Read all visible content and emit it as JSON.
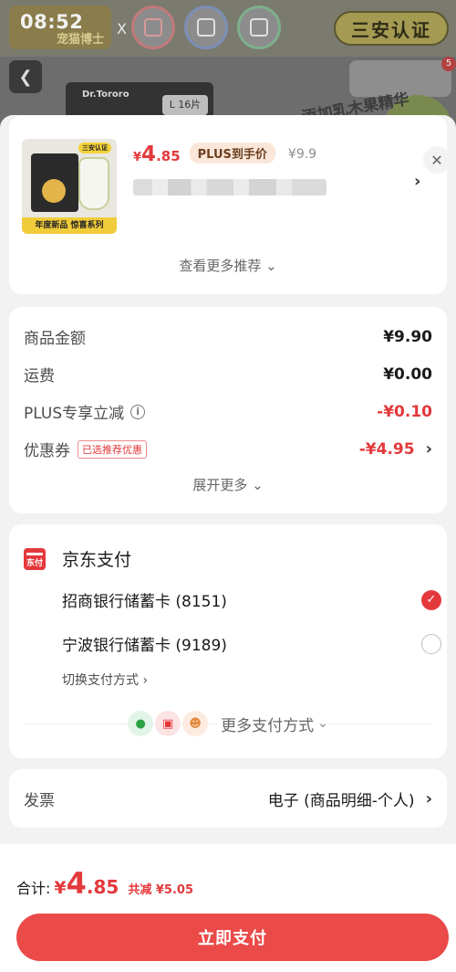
{
  "background": {
    "status_time": "08:52",
    "brand_text": "宠猫博士",
    "brand_multiplier": "X",
    "certification": "三安认证",
    "product_brand": "Dr.Tororo",
    "size_label": "L 16片",
    "slogan": "添加乳木果精华",
    "cart_badge": "5"
  },
  "product": {
    "thumb_cert": "三安认证",
    "thumb_banner": "年度新品 惊喜系列",
    "price_symbol": "¥",
    "price_int": "4",
    "price_dec": ".85",
    "plus_badge": "PLUS到手价",
    "original_price": "¥9.9",
    "more_recommend": "查看更多推荐"
  },
  "summary": {
    "rows": [
      {
        "label": "商品金额",
        "value": "¥9.90"
      },
      {
        "label": "运费",
        "value": "¥0.00"
      },
      {
        "label": "PLUS专享立减",
        "value": "-¥0.10"
      },
      {
        "label": "优惠券",
        "value": "-¥4.95",
        "tag": "已选推荐优惠"
      }
    ],
    "expand_more": "展开更多"
  },
  "payment": {
    "icon_text": "东付",
    "title": "京东支付",
    "cards": [
      {
        "name": "招商银行储蓄卡 (8151)",
        "selected": true
      },
      {
        "name": "宁波银行储蓄卡 (9189)",
        "selected": false
      }
    ],
    "switch_method": "切换支付方式 ›",
    "more_methods": "更多支付方式"
  },
  "invoice": {
    "label": "发票",
    "value": "电子 (商品明细-个人)"
  },
  "footer": {
    "total_label": "合计:",
    "currency": "¥",
    "total_int": "4",
    "total_dec": ".85",
    "saved": "共减 ¥5.05",
    "pay_button": "立即支付"
  },
  "colors": {
    "accent": "#e4393c",
    "pay_button": "#ea4a48"
  }
}
